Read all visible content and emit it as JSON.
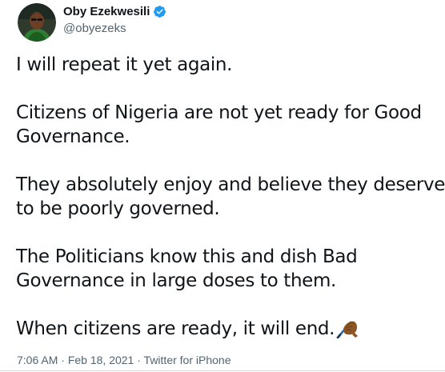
{
  "author": {
    "display_name": "Oby Ezekwesili",
    "handle": "@obyezeks",
    "verified_icon": "verified-badge-icon",
    "badge_color": "#1d9bf0"
  },
  "tweet": {
    "paragraphs": [
      "I will repeat it yet again.",
      "Citizens of Nigeria are not yet ready for Good Governance.",
      "They absolutely enjoy and believe they deserve to be poorly governed.",
      "The Politicians know this and dish Bad Governance in large doses to them.",
      "When citizens are ready, it will end."
    ],
    "trailing_emoji": "writing-hand-emoji-icon"
  },
  "meta": {
    "time": "7:06 AM",
    "separator": "·",
    "date": "Feb 18, 2021",
    "source": "Twitter for iPhone"
  },
  "colors": {
    "text": "#0f1419",
    "secondary": "#536471"
  }
}
